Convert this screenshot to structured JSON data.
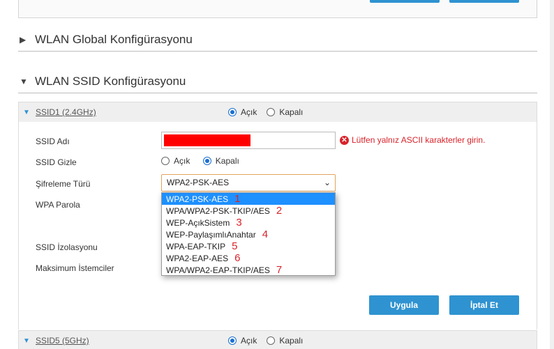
{
  "global_section": {
    "title": "WLAN Global Konfigürasyonu"
  },
  "ssid_section": {
    "title": "WLAN SSID Konfigürasyonu"
  },
  "ssid1": {
    "name": "SSID1 (2.4GHz)",
    "radio_on": "Açık",
    "radio_off": "Kapalı"
  },
  "form": {
    "ssid_name_label": "SSID Adı",
    "ssid_hide_label": "SSID Gizle",
    "hide_on": "Açık",
    "hide_off": "Kapalı",
    "encryption_label": "Şifreleme Türü",
    "encryption_value": "WPA2-PSK-AES",
    "wpa_password_label": "WPA Parola",
    "ssid_isolation_label": "SSID İzolasyonu",
    "max_clients_label": "Maksimum İstemciler",
    "error_text": "Lütfen yalnız ASCII karakterler girin."
  },
  "dropdown": {
    "options": [
      {
        "label": "WPA2-PSK-AES",
        "num": "1"
      },
      {
        "label": "WPA/WPA2-PSK-TKIP/AES",
        "num": "2"
      },
      {
        "label": "WEP-AçıkSistem",
        "num": "3"
      },
      {
        "label": "WEP-PaylaşımlıAnahtar",
        "num": "4"
      },
      {
        "label": "WPA-EAP-TKIP",
        "num": "5"
      },
      {
        "label": "WPA2-EAP-AES",
        "num": "6"
      },
      {
        "label": "WPA/WPA2-EAP-TKIP/AES",
        "num": "7"
      }
    ]
  },
  "buttons": {
    "apply": "Uygula",
    "cancel": "İptal Et"
  },
  "ssid5": {
    "name": "SSID5 (5GHz)",
    "radio_on": "Açık",
    "radio_off": "Kapalı"
  },
  "colors": {
    "accent": "#2f93d1",
    "error": "#d8232a",
    "selected_option": "#1e90ff"
  }
}
